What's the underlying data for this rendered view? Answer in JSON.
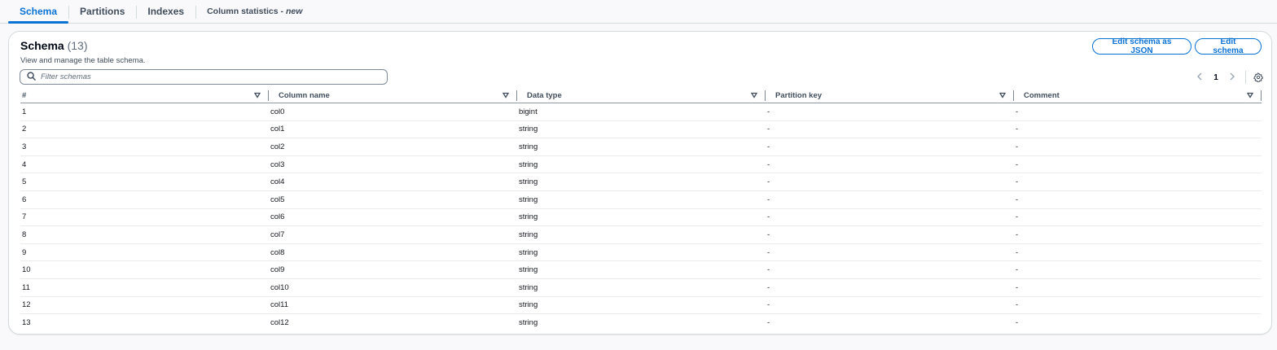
{
  "tabs": [
    {
      "label": "Schema",
      "active": true
    },
    {
      "label": "Partitions",
      "active": false
    },
    {
      "label": "Indexes",
      "active": false
    },
    {
      "label": "Column statistics - ",
      "suffix": "new",
      "active": false
    }
  ],
  "header": {
    "title": "Schema",
    "count": "(13)",
    "description": "View and manage the table schema.",
    "edit_json_label": "Edit schema as JSON",
    "edit_label": "Edit schema"
  },
  "filter": {
    "placeholder": "Filter schemas"
  },
  "pagination": {
    "current_page": "1"
  },
  "table": {
    "columns": [
      "#",
      "Column name",
      "Data type",
      "Partition key",
      "Comment"
    ],
    "rows": [
      [
        "1",
        "col0",
        "bigint",
        "-",
        "-"
      ],
      [
        "2",
        "col1",
        "string",
        "-",
        "-"
      ],
      [
        "3",
        "col2",
        "string",
        "-",
        "-"
      ],
      [
        "4",
        "col3",
        "string",
        "-",
        "-"
      ],
      [
        "5",
        "col4",
        "string",
        "-",
        "-"
      ],
      [
        "6",
        "col5",
        "string",
        "-",
        "-"
      ],
      [
        "7",
        "col6",
        "string",
        "-",
        "-"
      ],
      [
        "8",
        "col7",
        "string",
        "-",
        "-"
      ],
      [
        "9",
        "col8",
        "string",
        "-",
        "-"
      ],
      [
        "10",
        "col9",
        "string",
        "-",
        "-"
      ],
      [
        "11",
        "col10",
        "string",
        "-",
        "-"
      ],
      [
        "12",
        "col11",
        "string",
        "-",
        "-"
      ],
      [
        "13",
        "col12",
        "string",
        "-",
        "-"
      ]
    ]
  },
  "colors": {
    "accent": "#0972d3",
    "border": "#d5dbdb",
    "text": "#16191f"
  },
  "icons": [
    "search-icon",
    "chevron-left-icon",
    "chevron-right-icon",
    "settings-gear-icon",
    "sort-caret-icon"
  ]
}
